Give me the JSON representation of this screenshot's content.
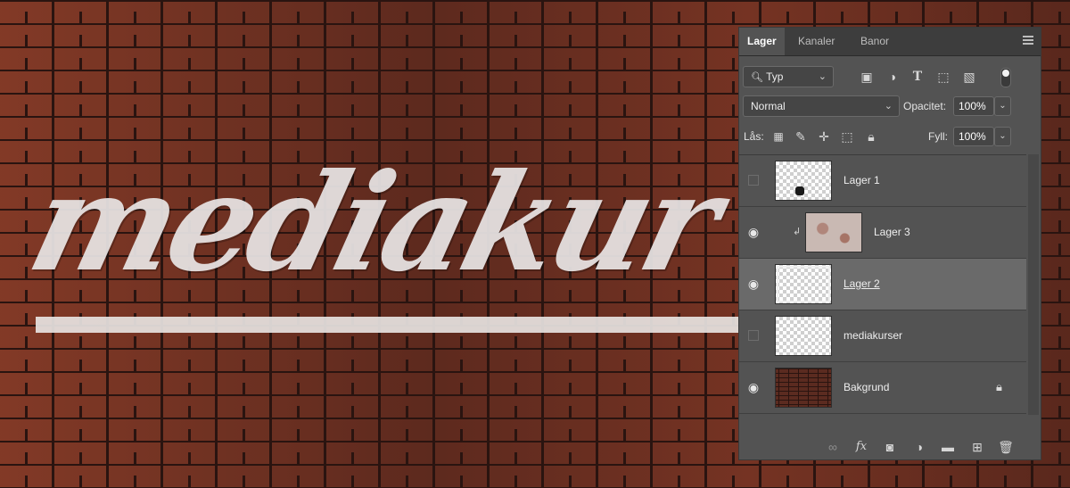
{
  "canvas": {
    "logo_text": "mediakur"
  },
  "panel": {
    "tabs": [
      {
        "label": "Lager",
        "active": true
      },
      {
        "label": "Kanaler",
        "active": false
      },
      {
        "label": "Banor",
        "active": false
      }
    ],
    "filter": {
      "label": "Typ",
      "icon": "search-icon"
    },
    "filter_icons": [
      "image-filter-icon",
      "adjustment-filter-icon",
      "type-filter-icon",
      "shape-filter-icon",
      "smart-object-filter-icon"
    ],
    "blend_mode": "Normal",
    "opacity_label": "Opacitet:",
    "opacity_value": "100%",
    "lock_label": "Lås:",
    "lock_icons": [
      "lock-transparency-icon",
      "lock-pixels-icon",
      "lock-position-icon",
      "lock-artboard-icon",
      "lock-all-icon"
    ],
    "fill_label": "Fyll:",
    "fill_value": "100%",
    "layers": [
      {
        "name": "Lager 1",
        "visible": false,
        "selected": false,
        "clipped": false,
        "locked": false
      },
      {
        "name": "Lager 3",
        "visible": true,
        "selected": false,
        "clipped": true,
        "locked": false
      },
      {
        "name": "Lager 2",
        "visible": true,
        "selected": true,
        "clipped": false,
        "locked": false
      },
      {
        "name": "mediakurser",
        "visible": false,
        "selected": false,
        "clipped": false,
        "locked": false
      },
      {
        "name": "Bakgrund",
        "visible": true,
        "selected": false,
        "clipped": false,
        "locked": true
      }
    ],
    "bottom_icons": [
      "link-layers-icon",
      "fx-icon",
      "add-mask-icon",
      "new-adjustment-icon",
      "new-group-icon",
      "new-layer-icon",
      "delete-layer-icon"
    ]
  }
}
